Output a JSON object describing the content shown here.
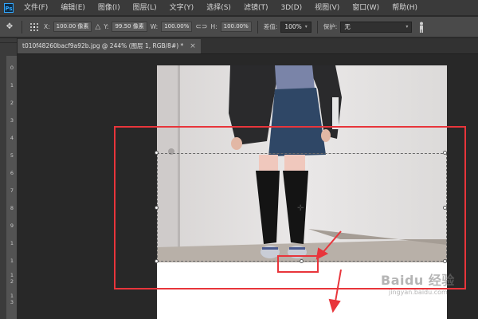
{
  "app": {
    "logo_text": "Ps",
    "menu": [
      "文件(F)",
      "编辑(E)",
      "图像(I)",
      "图层(L)",
      "文字(Y)",
      "选择(S)",
      "滤镜(T)",
      "3D(D)",
      "视图(V)",
      "窗口(W)",
      "帮助(H)"
    ]
  },
  "options": {
    "x_label": "X:",
    "x_value": "100.00 像素",
    "y_label": "Y:",
    "y_value": "99.50 像素",
    "w_label": "W:",
    "w_value": "100.00%",
    "h_label": "H:",
    "h_value": "100.00%",
    "interp_label": "差值:",
    "interp_value": "100%",
    "protect_label": "保护:",
    "protect_value": "无"
  },
  "document": {
    "tab_title": "t010f48260bacf9a92b.jpg @ 244% (图层 1, RGB/8#) *",
    "close_glyph": "×"
  },
  "ruler": {
    "labels": [
      "0",
      "1",
      "2",
      "3",
      "4",
      "5",
      "6",
      "7",
      "8",
      "9",
      "1",
      "1",
      "1",
      "2",
      "1",
      "3"
    ]
  },
  "watermark": {
    "main": "Baidu 经验",
    "sub": "jingyan.baidu.com"
  },
  "colors": {
    "annotation_red": "#e8353b",
    "menu_bg": "#3a3a3a",
    "options_bg": "#4a4a4a",
    "workspace_bg": "#282828"
  },
  "icons": [
    "move-tool-icon",
    "reference-point-icon",
    "triangle-delta-icon",
    "link-icon",
    "warp-icon",
    "person-icon",
    "close-icon"
  ]
}
